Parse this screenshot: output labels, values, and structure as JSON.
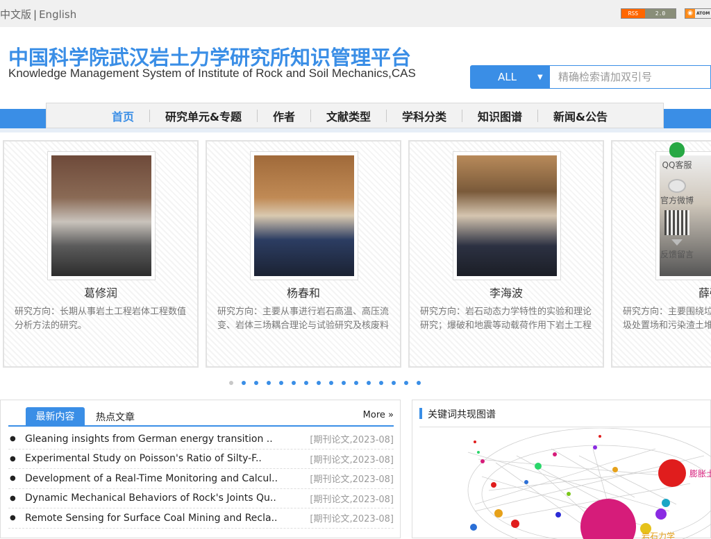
{
  "topbar": {
    "lang_cn": "中文版",
    "lang_sep": "|",
    "lang_en": "English",
    "rss_left": "RSS",
    "rss_right": "2.0",
    "atom_label": "ATOM"
  },
  "header": {
    "title_cn": "中国科学院武汉岩土力学研究所知识管理平台",
    "title_en": "Knowledge Management System of Institute of Rock and Soil Mechanics,CAS"
  },
  "search": {
    "scope": "ALL",
    "placeholder": "精确检索请加双引号"
  },
  "nav": [
    {
      "label": "首页",
      "active": true
    },
    {
      "label": "研究单元&专题"
    },
    {
      "label": "作者"
    },
    {
      "label": "文献类型"
    },
    {
      "label": "学科分类"
    },
    {
      "label": "知识图谱"
    },
    {
      "label": "新闻&公告"
    }
  ],
  "scholars": [
    {
      "name": "葛修润",
      "desc": "研究方向：长期从事岩土工程岩体工程数值分析方法的研究。"
    },
    {
      "name": "杨春和",
      "desc": "研究方向：主要从事进行岩石高温、高压流变、岩体三场耦合理论与试验研究及核废料"
    },
    {
      "name": "李海波",
      "desc": "研究方向：岩石动态力学特性的实验和理论研究；爆破和地震等动载荷作用下岩土工程"
    },
    {
      "name": "薛强",
      "desc": "研究方向：主要围绕垃圾处置场和污染渣土堆存"
    }
  ],
  "float_widget": {
    "qq": "QQ客服",
    "weibo": "官方微博",
    "feedback": "反馈留言"
  },
  "carousel": {
    "dot_count": 16,
    "active_dot": 0
  },
  "news": {
    "tab_latest": "最新内容",
    "tab_hot": "热点文章",
    "more": "More »",
    "items": [
      {
        "title": "Gleaning insights from German energy transition ..",
        "meta": "[期刊论文,2023-08]"
      },
      {
        "title": "Experimental Study on Poisson's Ratio of Silty-F..",
        "meta": "[期刊论文,2023-08]"
      },
      {
        "title": "Development of a Real-Time Monitoring and Calcul..",
        "meta": "[期刊论文,2023-08]"
      },
      {
        "title": "Dynamic Mechanical Behaviors of Rock's Joints Qu..",
        "meta": "[期刊论文,2023-08]"
      },
      {
        "title": "Remote Sensing for Surface Coal Mining and Recla..",
        "meta": "[期刊论文,2023-08]"
      }
    ]
  },
  "graph": {
    "title": "关键词共现图谱",
    "label_a": "膨胀土",
    "label_b": "岩石力学"
  }
}
